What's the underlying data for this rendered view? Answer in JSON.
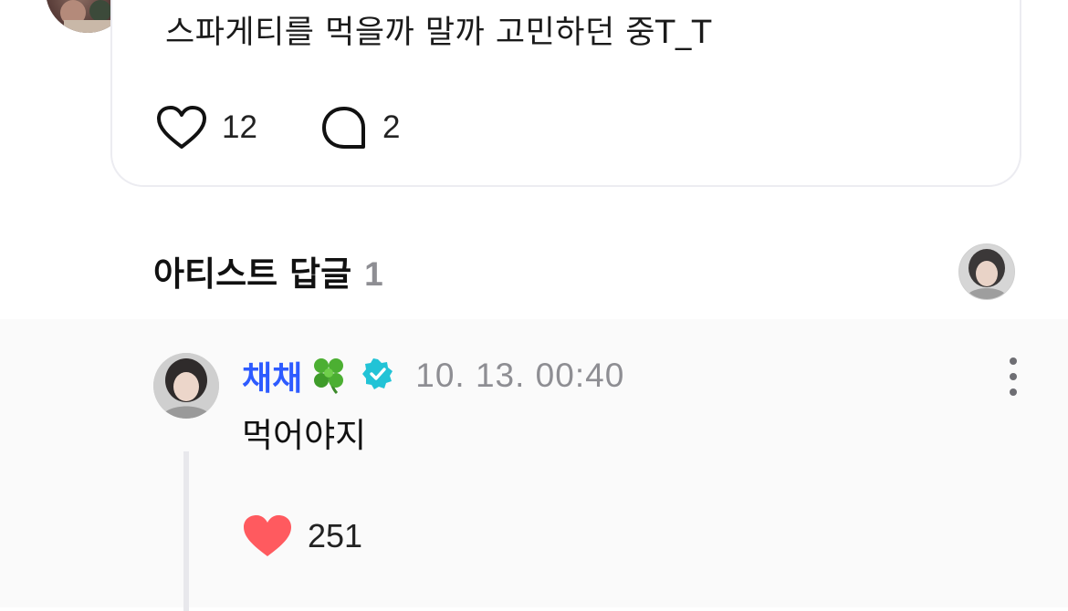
{
  "post": {
    "text": "스파게티를 먹을까 말까 고민하던 중T_T",
    "like_count": "12",
    "comment_count": "2"
  },
  "artist_replies": {
    "title": "아티스트 답글",
    "count": "1"
  },
  "reply": {
    "author": "채채",
    "timestamp": "10. 13. 00:40",
    "text": "먹어야지",
    "like_count": "251"
  },
  "icons": {
    "like": "heart-outline-icon",
    "comment": "speech-bubble-icon",
    "author_emoji": "four-leaf-clover-icon",
    "verified": "verified-badge-icon",
    "more": "more-vertical-icon",
    "reply_like": "heart-filled-icon"
  },
  "colors": {
    "author_name": "#2e5bff",
    "verified_badge": "#22c3d6",
    "heart_filled": "#ff5a5f",
    "muted_text": "#8e8e93"
  }
}
